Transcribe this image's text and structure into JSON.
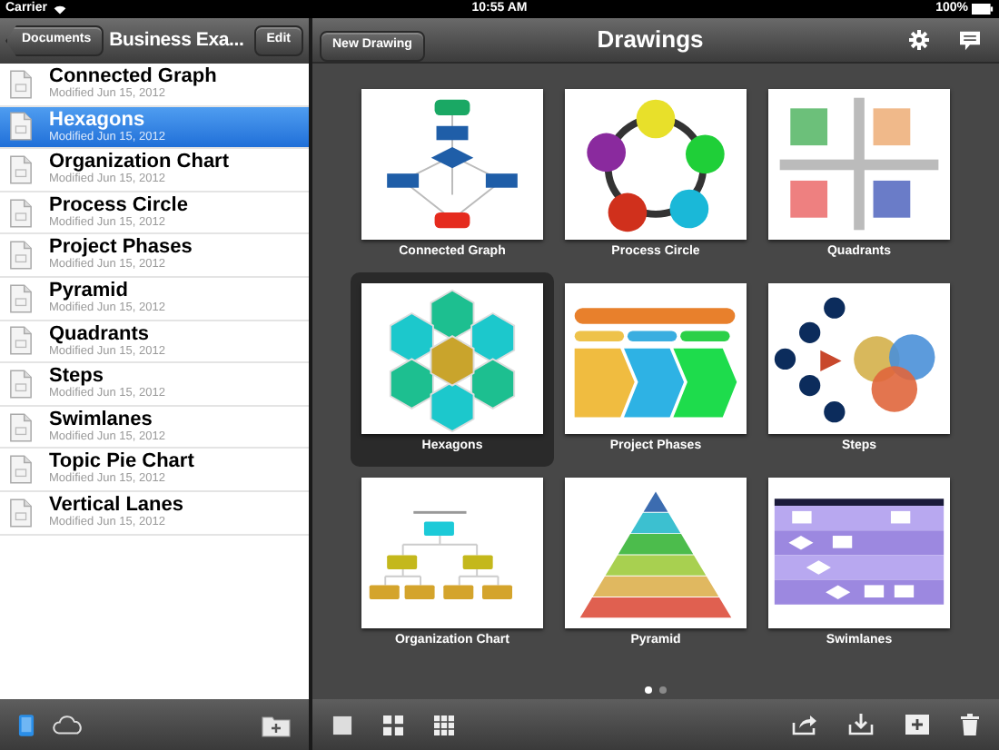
{
  "status_bar": {
    "carrier": "Carrier",
    "time": "10:55 AM",
    "battery": "100%"
  },
  "sidebar": {
    "back_button": "Documents",
    "title": "Business Exa...",
    "edit_button": "Edit",
    "items": [
      {
        "title": "Connected Graph",
        "subtitle": "Modified Jun 15, 2012",
        "selected": false
      },
      {
        "title": "Hexagons",
        "subtitle": "Modified Jun 15, 2012",
        "selected": true
      },
      {
        "title": "Organization Chart",
        "subtitle": "Modified Jun 15, 2012",
        "selected": false
      },
      {
        "title": "Process Circle",
        "subtitle": "Modified Jun 15, 2012",
        "selected": false
      },
      {
        "title": "Project Phases",
        "subtitle": "Modified Jun 15, 2012",
        "selected": false
      },
      {
        "title": "Pyramid",
        "subtitle": "Modified Jun 15, 2012",
        "selected": false
      },
      {
        "title": "Quadrants",
        "subtitle": "Modified Jun 15, 2012",
        "selected": false
      },
      {
        "title": "Steps",
        "subtitle": "Modified Jun 15, 2012",
        "selected": false
      },
      {
        "title": "Swimlanes",
        "subtitle": "Modified Jun 15, 2012",
        "selected": false
      },
      {
        "title": "Topic Pie Chart",
        "subtitle": "Modified Jun 15, 2012",
        "selected": false
      },
      {
        "title": "Vertical Lanes",
        "subtitle": "Modified Jun 15, 2012",
        "selected": false
      }
    ]
  },
  "main": {
    "new_drawing_button": "New Drawing",
    "title": "Drawings",
    "drawings": [
      {
        "kind": "flowchart",
        "label": "Connected Graph",
        "selected": false
      },
      {
        "kind": "cycle",
        "label": "Process Circle",
        "selected": false
      },
      {
        "kind": "quadrants",
        "label": "Quadrants",
        "selected": false
      },
      {
        "kind": "hexagons",
        "label": "Hexagons",
        "selected": true
      },
      {
        "kind": "phases",
        "label": "Project Phases",
        "selected": false
      },
      {
        "kind": "steps",
        "label": "Steps",
        "selected": false
      },
      {
        "kind": "orgchart",
        "label": "Organization Chart",
        "selected": false
      },
      {
        "kind": "pyramid",
        "label": "Pyramid",
        "selected": false
      },
      {
        "kind": "swimlanes",
        "label": "Swimlanes",
        "selected": false
      }
    ],
    "pager": [
      {
        "selected": true
      },
      {
        "selected": false
      }
    ]
  }
}
